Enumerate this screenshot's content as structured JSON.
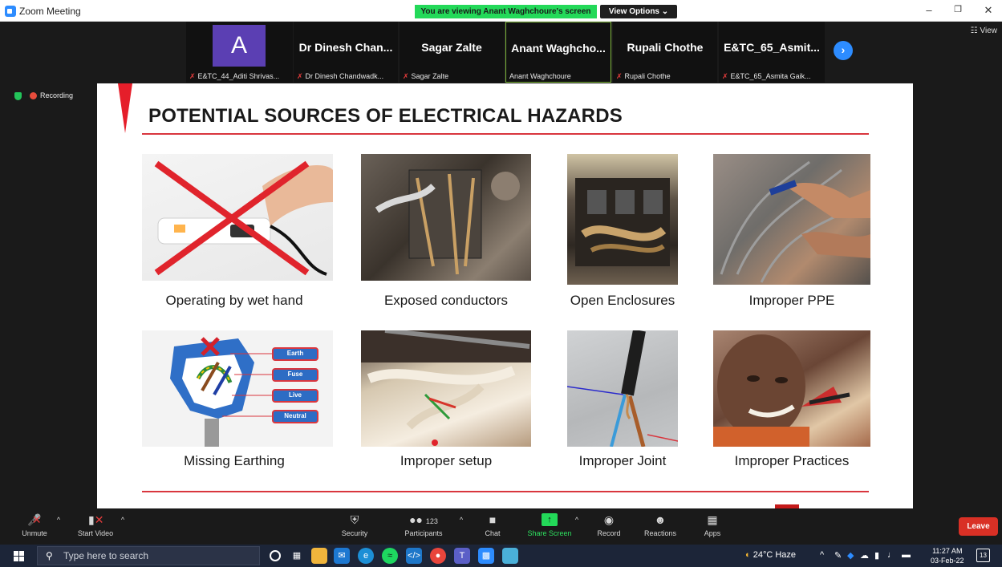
{
  "window": {
    "title": "Zoom Meeting",
    "viewing_banner": "You are viewing Anant Waghchoure's screen",
    "view_options": "View Options ⌄",
    "view_button": "☷ View"
  },
  "participants": [
    {
      "big": "A",
      "small": "E&TC_44_Aditi Shrivas...",
      "muted": true,
      "avatar": true
    },
    {
      "big": "Dr Dinesh Chan...",
      "small": "Dr Dinesh Chandwadk...",
      "muted": true
    },
    {
      "big": "Sagar Zalte",
      "small": "Sagar Zalte",
      "muted": true
    },
    {
      "big": "Anant Waghcho...",
      "small": "Anant Waghchoure",
      "muted": false,
      "active": true
    },
    {
      "big": "Rupali Chothe",
      "small": "Rupali Chothe",
      "muted": true
    },
    {
      "big": "E&TC_65_Asmit...",
      "small": "E&TC_65_Asmita Gaik...",
      "muted": true
    }
  ],
  "recording_label": "Recording",
  "slide": {
    "title": "POTENTIAL SOURCES OF ELECTRICAL HAZARDS",
    "items": [
      {
        "label": "Operating by wet hand"
      },
      {
        "label": "Exposed conductors"
      },
      {
        "label": "Open Enclosures"
      },
      {
        "label": "Improper PPE"
      },
      {
        "label": "Missing Earthing"
      },
      {
        "label": "Improper setup"
      },
      {
        "label": "Improper Joint"
      },
      {
        "label": "Improper Practices"
      }
    ],
    "earthing_tags": [
      "Earth",
      "Fuse",
      "Live",
      "Neutral"
    ]
  },
  "toolbar": {
    "unmute": "Unmute",
    "start_video": "Start Video",
    "security": "Security",
    "participants": "Participants",
    "participant_count": "123",
    "chat": "Chat",
    "share_screen": "Share Screen",
    "record": "Record",
    "reactions": "Reactions",
    "apps": "Apps",
    "leave": "Leave"
  },
  "taskbar": {
    "search_placeholder": "Type here to search",
    "weather": "24°C Haze",
    "time": "11:27 AM",
    "date": "03-Feb-22",
    "notifications": "13"
  },
  "colors": {
    "accent_red": "#e51e2a",
    "zoom_blue": "#2d8cff",
    "share_green": "#23d959",
    "leave_red": "#d93025"
  }
}
